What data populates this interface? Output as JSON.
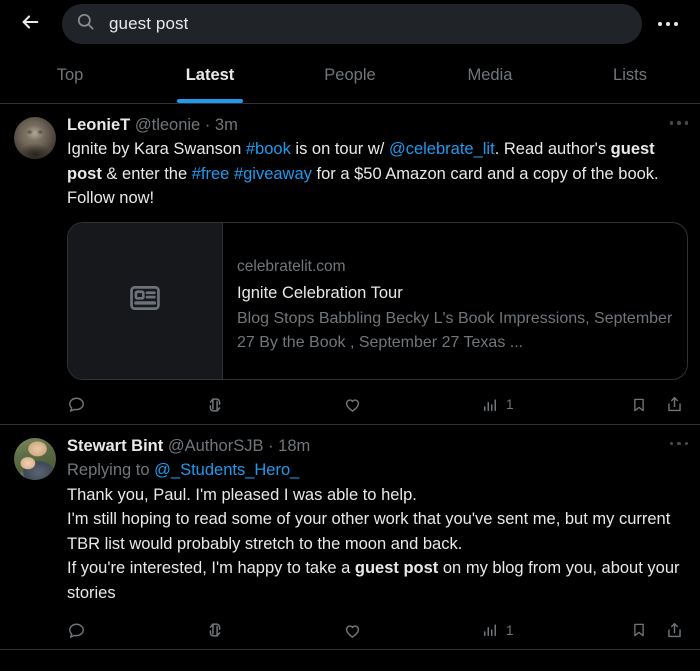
{
  "topbar": {
    "back_icon": "back-arrow-icon",
    "search_icon": "search-icon",
    "search_value": "guest post",
    "search_placeholder": "Search Twitter",
    "more_icon": "more-horizontal-icon"
  },
  "tabs": [
    {
      "label": "Top",
      "active": false
    },
    {
      "label": "Latest",
      "active": true
    },
    {
      "label": "People",
      "active": false
    },
    {
      "label": "Media",
      "active": false
    },
    {
      "label": "Lists",
      "active": false
    }
  ],
  "accent_color": "#1d9bf0",
  "tweets": [
    {
      "name": "LeonieT",
      "handle": "@tleonie",
      "separator": "·",
      "time": "3m",
      "text_runs": [
        {
          "t": "Ignite by Kara Swanson ",
          "style": "normal"
        },
        {
          "t": "#book",
          "style": "link"
        },
        {
          "t": " is on tour w/ ",
          "style": "normal"
        },
        {
          "t": "@celebrate_lit",
          "style": "link"
        },
        {
          "t": ". Read author's ",
          "style": "normal"
        },
        {
          "t": "guest post",
          "style": "bold"
        },
        {
          "t": " & enter the ",
          "style": "normal"
        },
        {
          "t": "#free",
          "style": "link"
        },
        {
          "t": " ",
          "style": "normal"
        },
        {
          "t": "#giveaway",
          "style": "link"
        },
        {
          "t": " for a $50 Amazon card and a  copy of the book. Follow now!",
          "style": "normal"
        }
      ],
      "card": {
        "domain": "celebratelit.com",
        "title": "Ignite Celebration Tour",
        "description": "Blog Stops Babbling Becky L's Book Impressions, September 27 By the Book , September 27 Texas ...",
        "thumb_icon": "article-placeholder-icon"
      },
      "actions": {
        "reply_count": "",
        "retweet_count": "",
        "like_count": "",
        "views_count": "1"
      }
    },
    {
      "name": "Stewart Bint",
      "handle": "@AuthorSJB",
      "separator": "·",
      "time": "18m",
      "replying_label": "Replying to",
      "replying_handle": "@_Students_Hero_",
      "text_runs": [
        {
          "t": "Thank you, Paul. I'm pleased I was able to help.",
          "style": "normal"
        },
        {
          "t": "\n",
          "style": "break"
        },
        {
          "t": "I'm still hoping to read some of your other work that you've sent me, but my current TBR list would probably stretch to the moon and back.",
          "style": "normal"
        },
        {
          "t": "\n",
          "style": "break"
        },
        {
          "t": "If you're interested, I'm happy to take a ",
          "style": "normal"
        },
        {
          "t": "guest post",
          "style": "bold"
        },
        {
          "t": " on my blog from you, about your stories",
          "style": "normal"
        }
      ],
      "actions": {
        "reply_count": "",
        "retweet_count": "",
        "like_count": "",
        "views_count": "1"
      }
    }
  ]
}
